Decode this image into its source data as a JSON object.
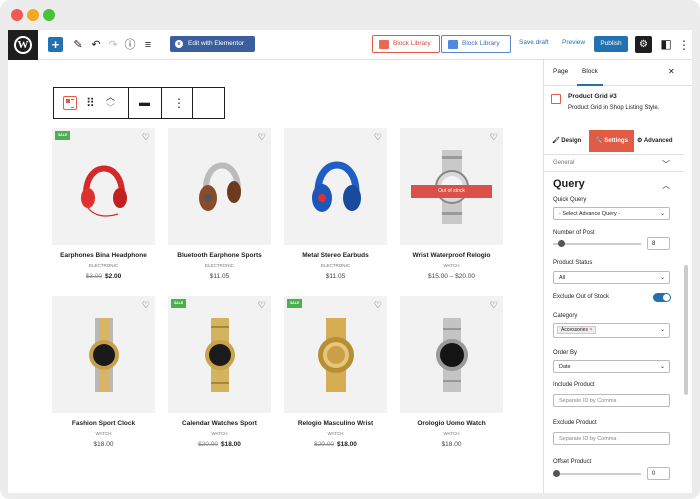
{
  "toolbar": {
    "edit_elementor_label": "Edit with Elementor",
    "block_library_1": "Block Library",
    "block_library_2": "Block Library",
    "save_draft_label": "Save draft",
    "preview_label": "Preview",
    "publish_label": "Publish"
  },
  "products": [
    {
      "title": "Earphones Bina Headphone",
      "category": "ELECTRONIC",
      "old_price": "$3.00",
      "price": "$2.00",
      "sale": true,
      "out_of_stock": false
    },
    {
      "title": "Bluetooth Earphone Sports",
      "category": "ELECTRONIC",
      "old_price": "",
      "price": "$11.05",
      "sale": false,
      "out_of_stock": false
    },
    {
      "title": "Metal Stereo Earbuds",
      "category": "ELECTRONIC",
      "old_price": "",
      "price": "$11.05",
      "sale": false,
      "out_of_stock": false
    },
    {
      "title": "Wrist Waterproof Relogio",
      "category": "WATCH",
      "old_price": "",
      "price": "$15.00 – $20.00",
      "sale": false,
      "out_of_stock": true,
      "out_of_stock_label": "Out of stock"
    },
    {
      "title": "Fashion Sport Clock",
      "category": "WATCH",
      "old_price": "",
      "price": "$18.00",
      "sale": false,
      "out_of_stock": false
    },
    {
      "title": "Calendar Watches Sport",
      "category": "WATCH",
      "old_price": "$20.00",
      "price": "$18.00",
      "sale": true,
      "out_of_stock": false
    },
    {
      "title": "Relogio Masculino Wrist",
      "category": "WATCH",
      "old_price": "$20.00",
      "price": "$18.00",
      "sale": true,
      "out_of_stock": false
    },
    {
      "title": "Orologio Uomo Watch",
      "category": "WATCH",
      "old_price": "",
      "price": "$18.00",
      "sale": false,
      "out_of_stock": false
    }
  ],
  "sale_badge": "SALE",
  "sidebar": {
    "tab_page": "Page",
    "tab_block": "Block",
    "block_name": "Product Grid #3",
    "block_desc": "Product Grid in Shop Listing Style.",
    "style_tabs": [
      "Design",
      "Settings",
      "Advanced"
    ],
    "general_label": "General",
    "query_heading": "Query",
    "quick_query_label": "Quick Query",
    "quick_query_value": "- Select Advance Query -",
    "number_of_post_label": "Number of Post",
    "number_of_post_value": "8",
    "product_status_label": "Product Status",
    "product_status_value": "All",
    "exclude_oos_label": "Exclude Out of Stock",
    "exclude_oos_enabled": true,
    "category_label": "Category",
    "category_tag": "Accessories",
    "order_by_label": "Order By",
    "order_by_value": "Date",
    "include_product_label": "Include Product",
    "include_product_placeholder": "Separate ID by Comma",
    "exclude_product_label": "Exclude Product",
    "exclude_product_placeholder": "Separate ID by Comma",
    "offset_label": "Offset Product",
    "offset_value": "0"
  },
  "colors": {
    "accent_blue": "#2271b1",
    "settings_tab": "#e25b44",
    "sale_green": "#4caf50",
    "out_of_stock_red": "#d95148"
  }
}
